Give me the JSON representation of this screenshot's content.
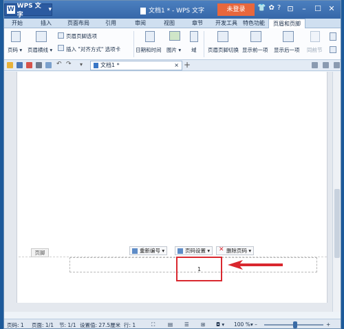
{
  "app": {
    "name": "WPS 文字",
    "title": "文档1 * - WPS 文字",
    "login": "未登录"
  },
  "tabs": [
    {
      "label": "开始"
    },
    {
      "label": "插入"
    },
    {
      "label": "页面布局"
    },
    {
      "label": "引用"
    },
    {
      "label": "审阅"
    },
    {
      "label": "视图"
    },
    {
      "label": "章节"
    },
    {
      "label": "开发工具"
    },
    {
      "label": "特色功能"
    },
    {
      "label": "页眉和页脚"
    }
  ],
  "ribbon": {
    "page_num": "页码",
    "header_line": "页眉横线",
    "header_footer_options": "页眉页脚选项",
    "insert_align_tab": "插入 \"对齐方式\" 选项卡",
    "datetime": "日期和时间",
    "image": "图片",
    "field": "域",
    "switch": "页眉页脚切换",
    "show_prev": "显示前一项",
    "show_next": "显示后一项",
    "same_as_prev": "同前节"
  },
  "document_tab": {
    "name": "文档1 *"
  },
  "footer": {
    "label": "页脚",
    "renumber": "重新编号",
    "page_settings": "页码设置",
    "delete_page_num": "删除页码",
    "page_number_value": "1"
  },
  "status": {
    "page_num": "页码: 1",
    "pages": "页面: 1/1",
    "section": "节: 1/1",
    "setting": "设置值: 27.5厘米",
    "row": "行: 1",
    "zoom": "100 %"
  },
  "colors": {
    "accent": "#3667a8",
    "highlight": "#d9272e",
    "login": "#e8673c"
  }
}
